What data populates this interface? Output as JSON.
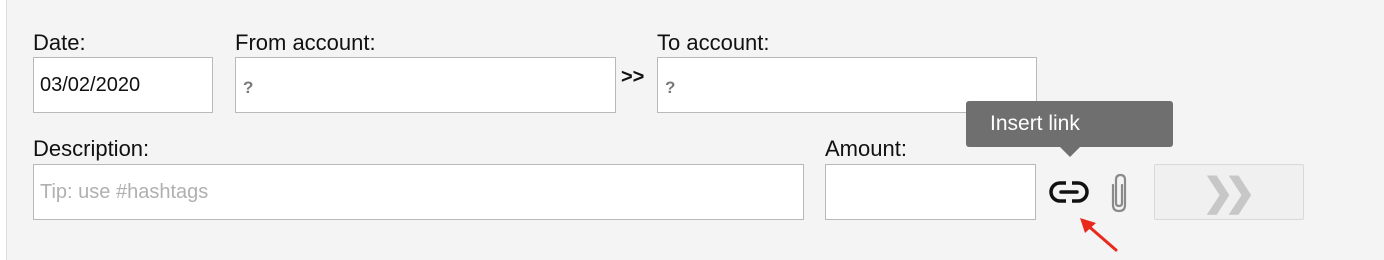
{
  "form": {
    "date": {
      "label": "Date:",
      "value": "03/02/2020"
    },
    "from_account": {
      "label": "From account:",
      "value": "?"
    },
    "transfer_arrow": ">>",
    "to_account": {
      "label": "To account:",
      "value": "?"
    },
    "description": {
      "label": "Description:",
      "placeholder": "Tip: use #hashtags",
      "value": ""
    },
    "amount": {
      "label": "Amount:",
      "value": ""
    }
  },
  "actions": {
    "insert_link_icon": "link-icon",
    "attach_icon": "paperclip-icon",
    "tooltip": "Insert link",
    "next_button_glyph": "❯❯"
  },
  "annotation": {
    "arrow_color": "#e8291c"
  }
}
